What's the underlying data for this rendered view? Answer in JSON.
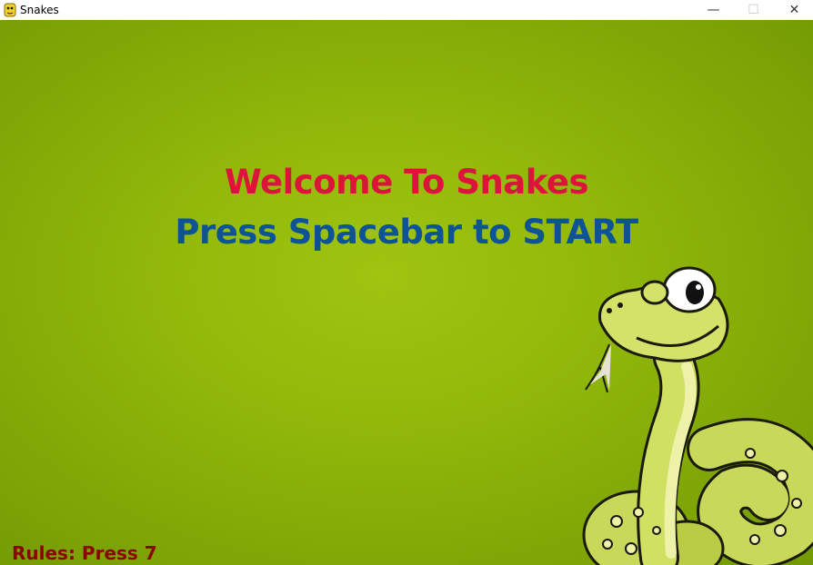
{
  "window": {
    "title": "Snakes",
    "minimize_glyph": "—",
    "maximize_glyph": "☐",
    "close_glyph": "✕"
  },
  "game": {
    "welcome_text": "Welcome To Snakes",
    "prompt_text": "Press Spacebar to START",
    "rules_text": "Rules: Press 7"
  },
  "colors": {
    "background": "#92b90a",
    "welcome": "#dc143c",
    "prompt": "#0e5494",
    "rules": "#8b0000"
  },
  "icons": [
    "python-app-icon",
    "snake-mascot"
  ]
}
